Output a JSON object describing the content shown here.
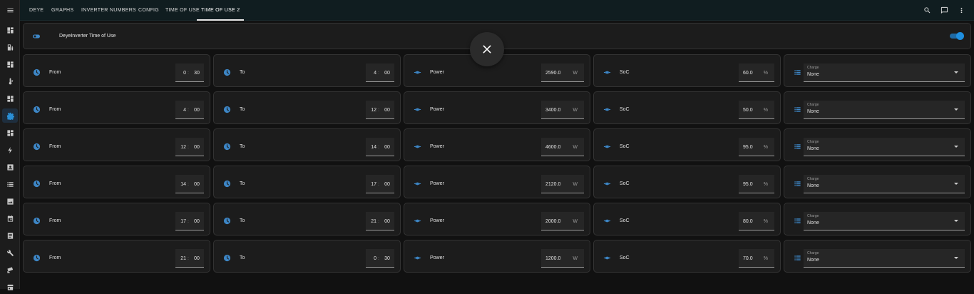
{
  "topbar": {
    "tabs": [
      {
        "label": "DEYE",
        "active": false
      },
      {
        "label": "GRAPHS",
        "active": false
      },
      {
        "label": "INVERTER NUMBERS",
        "active": false
      },
      {
        "label": "CONFIG",
        "active": false
      },
      {
        "label": "TIME OF USE",
        "active": false
      },
      {
        "label": "TIME OF USE 2",
        "active": true
      }
    ],
    "icons": [
      "search-icon",
      "assist-icon",
      "more-vertical-icon"
    ]
  },
  "sidebar": {
    "menu_icon": "menu-icon",
    "items": [
      {
        "icon": "dashboard-icon",
        "active": false
      },
      {
        "icon": "ev-station-icon",
        "active": false
      },
      {
        "icon": "dashboard-icon",
        "active": false
      },
      {
        "icon": "thermometer-icon",
        "active": false
      },
      {
        "icon": "dashboard-icon",
        "active": false
      },
      {
        "icon": "settings-icon",
        "active": true
      },
      {
        "icon": "dashboard-icon",
        "active": false
      },
      {
        "icon": "lightning-icon",
        "active": false
      },
      {
        "icon": "account-box-icon",
        "active": false
      },
      {
        "icon": "list-icon",
        "active": false
      },
      {
        "icon": "image-icon",
        "active": false
      },
      {
        "icon": "calendar-icon",
        "active": false
      },
      {
        "icon": "logbook-icon",
        "active": false
      },
      {
        "icon": "wrench-icon",
        "active": false
      },
      {
        "icon": "cctv-icon",
        "active": false
      },
      {
        "icon": "store-icon",
        "active": false
      }
    ]
  },
  "header_card": {
    "title": "DeyeInverter Time of Use",
    "toggle_on": true
  },
  "labels": {
    "from": "From",
    "to": "To",
    "power": "Power",
    "soc": "SoC",
    "select_label": "Charge",
    "power_unit": "W",
    "soc_unit": "%"
  },
  "rows": [
    {
      "from_h": "0",
      "from_m": "30",
      "to_h": "4",
      "to_m": "00",
      "power": "2590.0",
      "soc": "60.0",
      "charge": "None"
    },
    {
      "from_h": "4",
      "from_m": "00",
      "to_h": "12",
      "to_m": "00",
      "power": "3400.0",
      "soc": "50.0",
      "charge": "None"
    },
    {
      "from_h": "12",
      "from_m": "00",
      "to_h": "14",
      "to_m": "00",
      "power": "4600.0",
      "soc": "95.0",
      "charge": "None"
    },
    {
      "from_h": "14",
      "from_m": "00",
      "to_h": "17",
      "to_m": "00",
      "power": "2120.0",
      "soc": "95.0",
      "charge": "None"
    },
    {
      "from_h": "17",
      "from_m": "00",
      "to_h": "21",
      "to_m": "00",
      "power": "2000.0",
      "soc": "80.0",
      "charge": "None"
    },
    {
      "from_h": "21",
      "from_m": "00",
      "to_h": "0",
      "to_m": "30",
      "power": "1200.0",
      "soc": "70.0",
      "charge": "None"
    }
  ],
  "colors": {
    "accent": "#2a8fd6",
    "toggle": "#1f8fe0",
    "icon_blue": "#3d86c6"
  }
}
